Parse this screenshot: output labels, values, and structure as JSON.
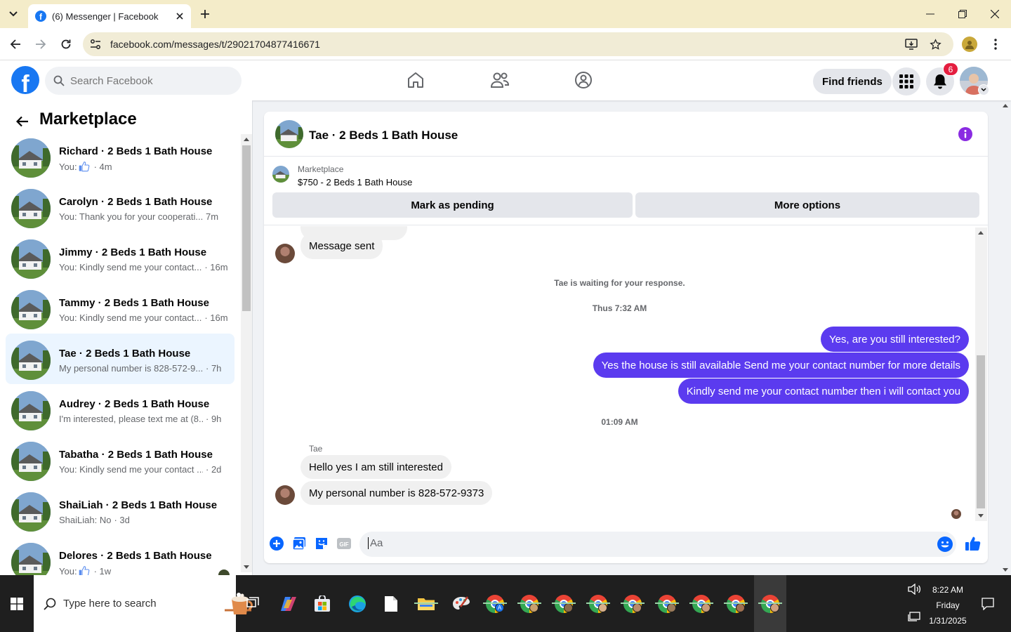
{
  "browser": {
    "tab_title": "(6) Messenger | Facebook",
    "url": "facebook.com/messages/t/29021704877416671"
  },
  "fb": {
    "search_placeholder": "Search Facebook",
    "find_friends": "Find friends",
    "notification_count": "6",
    "brand_color": "#1877f2"
  },
  "marketplace": {
    "title": "Marketplace",
    "conversations": [
      {
        "name": "Richard · 2 Beds 1 Bath House",
        "prefix": "You: ",
        "snippet": "",
        "like": true,
        "time": "· 4m",
        "active": false
      },
      {
        "name": "Carolyn · 2 Beds 1 Bath House",
        "prefix": "",
        "snippet": "You: Thank you for your cooperati...",
        "like": false,
        "time": "7m",
        "active": false
      },
      {
        "name": "Jimmy · 2 Beds 1 Bath House",
        "prefix": "",
        "snippet": "You: Kindly send me your contact...",
        "like": false,
        "time": "· 16m",
        "active": false
      },
      {
        "name": "Tammy · 2 Beds 1 Bath House",
        "prefix": "",
        "snippet": "You: Kindly send me your contact...",
        "like": false,
        "time": "· 16m",
        "active": false
      },
      {
        "name": "Tae · 2 Beds 1 Bath House",
        "prefix": "",
        "snippet": "My personal number is 828-572-9...",
        "like": false,
        "time": "· 7h",
        "active": true
      },
      {
        "name": "Audrey · 2 Beds 1 Bath House",
        "prefix": "",
        "snippet": "I'm interested, please text me at (8...",
        "like": false,
        "time": "· 9h",
        "active": false
      },
      {
        "name": "Tabatha · 2 Beds 1 Bath House",
        "prefix": "",
        "snippet": "You: Kindly send me your contact ...",
        "like": false,
        "time": "· 2d",
        "active": false
      },
      {
        "name": "ShaiLiah · 2 Beds 1 Bath House",
        "prefix": "",
        "snippet": "ShaiLiah: No",
        "like": false,
        "time": "· 3d",
        "active": false
      },
      {
        "name": "Delores · 2 Beds 1 Bath House",
        "prefix": "You: ",
        "snippet": "",
        "like": true,
        "time": "· 1w",
        "active": false,
        "seen_dot": true
      }
    ]
  },
  "chat": {
    "title": "Tae · 2 Beds 1 Bath House",
    "listing_label": "Marketplace",
    "listing_price": "$750 - 2 Beds 1 Bath House",
    "mark_pending": "Mark as pending",
    "more_options": "More options",
    "msg_sent": "Message sent",
    "waiting": "Tae is waiting for your response.",
    "time_1": "Thus 7:32 AM",
    "out_1": "Yes, are you still interested?",
    "out_2": "Yes the house is still available Send me your contact number for more details",
    "out_3": "Kindly send me your contact number then i will contact you",
    "time_2": "01:09 AM",
    "sender": "Tae",
    "in_1": "Hello yes I am still interested",
    "in_2": "My personal number is 828-572-9373",
    "composer_placeholder": "Aa",
    "accent": "#5b3bef"
  },
  "taskbar": {
    "search_placeholder": "Type here to search",
    "time": "8:22 AM",
    "day": "Friday",
    "date": "1/31/2025"
  }
}
